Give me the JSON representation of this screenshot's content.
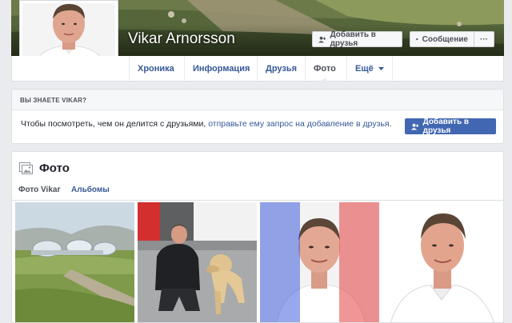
{
  "profile": {
    "name": "Vikar Arnorsson"
  },
  "cover_actions": {
    "add_friend": "Добавить в друзья",
    "message": "Сообщение",
    "more": "···"
  },
  "nav": {
    "items": [
      {
        "label": "Хроника"
      },
      {
        "label": "Информация"
      },
      {
        "label": "Друзья"
      },
      {
        "label": "Фото"
      },
      {
        "label": "Ещё"
      }
    ]
  },
  "know_box": {
    "heading": "ВЫ ЗНАЕТЕ VIKAR?",
    "text_before": "Чтобы посмотреть, чем он делится с друзьями, ",
    "link": "отправьте ему запрос на добавление в друзья",
    "text_after": ".",
    "button": "Добавить в друзья"
  },
  "photos": {
    "title": "Фото",
    "tabs": [
      "Фото Vikar",
      "Альбомы"
    ]
  },
  "colors": {
    "link": "#365899",
    "primary_button": "#4267b2",
    "background": "#e9ebee"
  }
}
